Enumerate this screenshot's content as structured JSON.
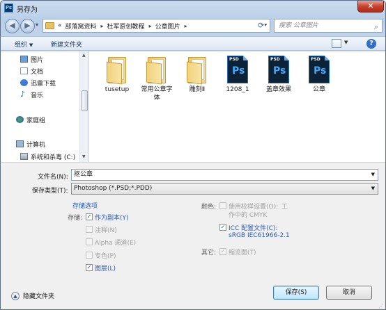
{
  "window": {
    "title": "另存为",
    "app_icon_text": "Ps",
    "close_symbol": "✕"
  },
  "address_bar": {
    "back_symbol": "◀",
    "forward_symbol": "▶",
    "overflow": "«",
    "crumbs": [
      "部落窝资料",
      "杜军原创教程",
      "公章图片"
    ],
    "separator": "▸",
    "search_placeholder": "搜索 公章图片"
  },
  "toolbar": {
    "organize": "组织",
    "new_folder": "新建文件夹"
  },
  "sidebar": {
    "items": [
      {
        "label": "图片",
        "icon": "pictures-icon"
      },
      {
        "label": "文档",
        "icon": "documents-icon"
      },
      {
        "label": "迅雷下载",
        "icon": "download-icon"
      },
      {
        "label": "音乐",
        "icon": "music-icon"
      },
      {
        "label": "家庭组",
        "icon": "homegroup-icon"
      },
      {
        "label": "计算机",
        "icon": "computer-icon"
      },
      {
        "label": "系统和杀毒 (C:)",
        "icon": "drive-icon"
      }
    ]
  },
  "files": [
    {
      "name": "tusetup",
      "type": "folder"
    },
    {
      "name": "常用公章字体",
      "type": "folder"
    },
    {
      "name": "雕刻Ⅱ",
      "type": "folder"
    },
    {
      "name": "1208_1",
      "type": "psd"
    },
    {
      "name": "盖章效果",
      "type": "psd"
    },
    {
      "name": "公章",
      "type": "psd"
    }
  ],
  "psd_tag": "PSD",
  "psd_logo": "Ps",
  "form": {
    "filename_label": "文件名(N):",
    "filename_value": "抠公章",
    "filetype_label": "保存类型(T):",
    "filetype_value": "Photoshop (*.PSD;*.PDD)"
  },
  "options": {
    "title": "存储选项",
    "save_label": "存储:",
    "as_copy": "作为副本(Y)",
    "notes": "注释(N)",
    "alpha": "Alpha 通道(E)",
    "spot": "专色(P)",
    "layers": "图层(L)",
    "color_label": "颜色:",
    "proof_line1": "使用校样设置(O):",
    "proof_suffix": "工",
    "proof_line2": "作中的 CMYK",
    "icc_line1": "ICC 配置文件(C):",
    "icc_line2": "sRGB IEC61966-2.1",
    "other_label": "其它:",
    "thumbnail": "缩览图(T)",
    "as_copy_checked": true,
    "layers_checked": true,
    "icc_checked": true,
    "thumbnail_checked": true
  },
  "footer": {
    "hide_folders": "隐藏文件夹",
    "save_button": "保存(S)",
    "cancel_button": "取消"
  }
}
